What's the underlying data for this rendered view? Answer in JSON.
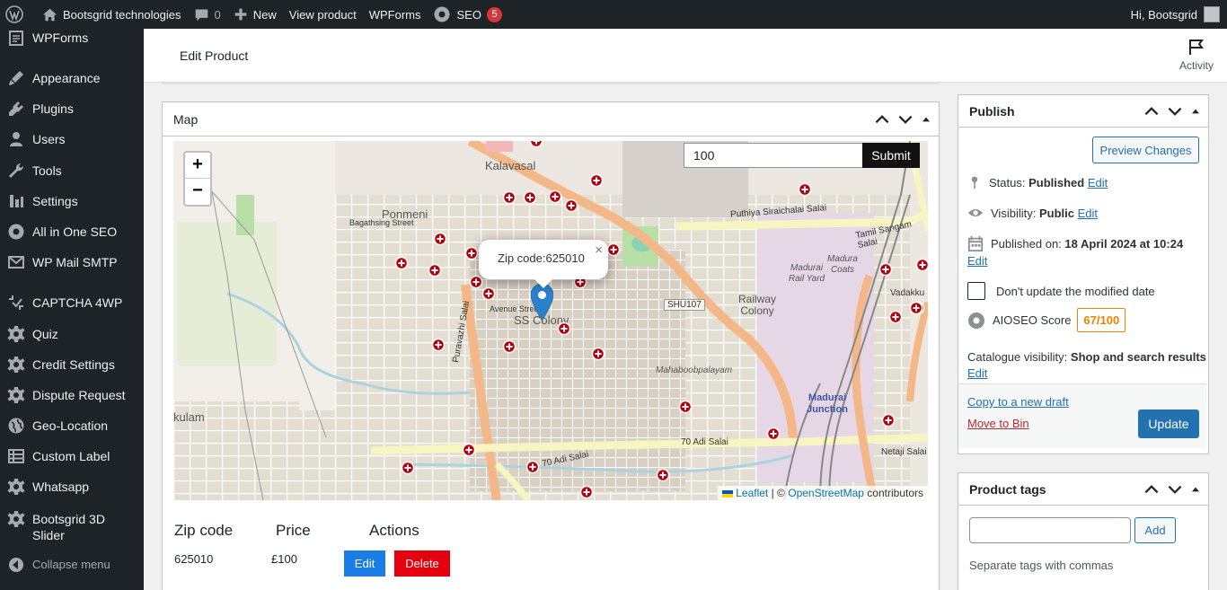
{
  "adminbar": {
    "site_name": "Bootsgrid technologies",
    "comments_count": "0",
    "new_label": "New",
    "view_product": "View product",
    "wpforms": "WPForms",
    "seo": "SEO",
    "seo_badge": "5",
    "greeting": "Hi, Bootsgrid"
  },
  "sidebar": {
    "items": [
      {
        "label": "WPForms",
        "icon": "wpforms-icon"
      },
      {
        "label": "Appearance",
        "icon": "brush-icon"
      },
      {
        "label": "Plugins",
        "icon": "plugin-icon"
      },
      {
        "label": "Users",
        "icon": "user-icon"
      },
      {
        "label": "Tools",
        "icon": "wrench-icon"
      },
      {
        "label": "Settings",
        "icon": "settings-icon"
      },
      {
        "label": "All in One SEO",
        "icon": "aioseo-icon"
      },
      {
        "label": "WP Mail SMTP",
        "icon": "mail-icon"
      },
      {
        "label": "CAPTCHA 4WP",
        "icon": "captcha-icon"
      },
      {
        "label": "Quiz",
        "icon": "gear-icon"
      },
      {
        "label": "Credit Settings",
        "icon": "gear-icon"
      },
      {
        "label": "Dispute Request",
        "icon": "gear-icon"
      },
      {
        "label": "Geo-Location",
        "icon": "globe-icon"
      },
      {
        "label": "Custom Label",
        "icon": "table-icon"
      },
      {
        "label": "Whatsapp",
        "icon": "gear-icon"
      },
      {
        "label": "Bootsgrid 3D Slider",
        "icon": "gear-icon"
      },
      {
        "label": "Collapse menu",
        "icon": "collapse-icon"
      }
    ]
  },
  "header": {
    "title": "Edit Product",
    "activity": "Activity"
  },
  "map_box": {
    "title": "Map",
    "search_value": "100",
    "submit_label": "Submit",
    "zoom_in": "+",
    "zoom_out": "−",
    "popup_text": "Zip code:625010",
    "popup_close": "×",
    "attribution": {
      "leaflet": "Leaflet",
      "sep": "| ©",
      "osm": "OpenStreetMap",
      "contributors": "contributors"
    },
    "labels": {
      "kalavasal": "Kalavasal",
      "ponmeni": "Ponmeni",
      "ss_colony": "SS Colony",
      "railway_colony": "Railway Colony",
      "madurai_rail_yard": "Madurai Rail Yard",
      "madura_coats": "Madura Coats",
      "madurai_junction": "Madurai Junction",
      "mahaboob": "Mahaboobpalayam",
      "puthiya": "Puthiya Siraichalai Salai",
      "tamil_sangam": "Tamil Sangam Salai",
      "adi_salai_1": "70 Adi Salai",
      "adi_salai_2": "70 Adi Salai",
      "puravazhi": "Puravazhi Salai",
      "shu107": "SHU107",
      "bagathsing": "Bagathsing Street",
      "vadakku": "Vadakku",
      "netaji": "Netaji Salai",
      "kulam": "kulam",
      "avenue": "Avenue Street"
    }
  },
  "zip_table": {
    "headers": [
      "Zip code",
      "Price",
      "Actions"
    ],
    "rows": [
      {
        "zip": "625010",
        "price": "£100",
        "edit": "Edit",
        "delete": "Delete"
      }
    ]
  },
  "publish": {
    "title": "Publish",
    "preview": "Preview Changes",
    "status_label": "Status:",
    "status_value": "Published",
    "visibility_label": "Visibility:",
    "visibility_value": "Public",
    "published_label": "Published on:",
    "published_value": "18 April 2024 at 10:24",
    "edit": "Edit",
    "dont_update": "Don't update the modified date",
    "aioseo_label": "AIOSEO Score",
    "aioseo_score": "67/100",
    "catalogue_label": "Catalogue visibility:",
    "catalogue_value": "Shop and search results",
    "copy_draft": "Copy to a new draft",
    "move_bin": "Move to Bin",
    "update": "Update"
  },
  "tags": {
    "title": "Product tags",
    "input_value": "",
    "add": "Add",
    "hint": "Separate tags with commas"
  },
  "colors": {
    "admin_bg": "#1d2327",
    "accent": "#2271b1",
    "marker_red": "#b3000c",
    "pin_blue": "#2a81cb",
    "delete_red": "#e6000f",
    "edit_blue": "#1a7ee6"
  }
}
